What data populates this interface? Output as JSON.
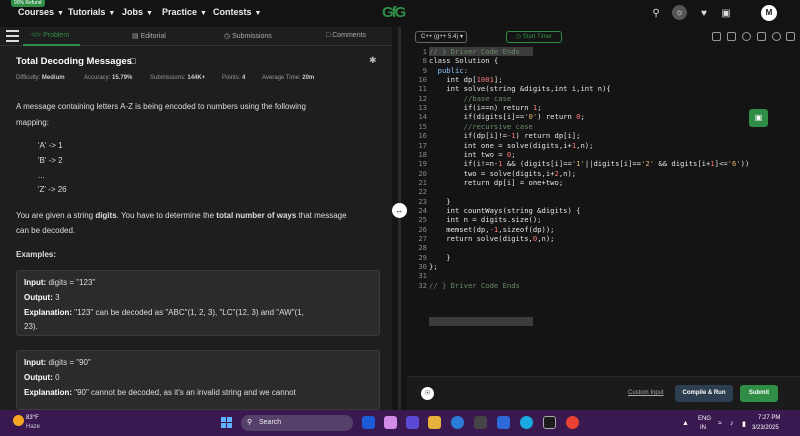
{
  "topnav": {
    "badge": "90% Refund",
    "items": [
      "Courses",
      "Tutorials",
      "Jobs",
      "Practice",
      "Contests"
    ],
    "logo": "GfG",
    "avatar_letter": "M"
  },
  "tabs": {
    "problem": "Problem",
    "editorial": "Editorial",
    "submissions": "Submissions",
    "comments": "Comments"
  },
  "problem": {
    "title": "Total Decoding Messages",
    "difficulty_label": "Difficulty:",
    "difficulty": "Medium",
    "accuracy_label": "Accuracy:",
    "accuracy": "15.79%",
    "submissions_label": "Submissions:",
    "submissions": "144K+",
    "points_label": "Points:",
    "points": "4",
    "avg_time_label": "Average Time:",
    "avg_time": "20m",
    "desc1": "A message containing letters A-Z is being encoded to numbers using the following",
    "desc2": "mapping:",
    "map1": "'A' -> 1",
    "map2": "'B' -> 2",
    "map3": "...",
    "map4": "'Z' -> 26",
    "desc3a": "You are given a string ",
    "desc3b": "digits",
    "desc3c": ". You have to determine the ",
    "desc3d": "total number of ways",
    "desc3e": " that message",
    "desc4": "can be decoded.",
    "examples": "Examples:"
  },
  "ex1": {
    "input_label": "Input:",
    "input": " digits = \"123\"",
    "output_label": "Output:",
    "output": " 3",
    "expl_label": "Explanation:",
    "expl1": " \"123\" can be decoded as \"ABC\"(1, 2, 3), \"LC\"(12, 3) and \"AW\"(1,",
    "expl2": "23)."
  },
  "ex2": {
    "input_label": "Input:",
    "input": " digits = \"90\"",
    "output_label": "Output:",
    "output": " 0",
    "expl_label": "Explanation:",
    "expl1": " \"90\" cannot be decoded, as it's an invalid string and we cannot"
  },
  "editor": {
    "language": "C++ (g++ 5.4)",
    "timer": "Start Timer",
    "line_numbers": [
      "1",
      "8",
      "9",
      "10",
      "11",
      "12",
      "13",
      "14",
      "15",
      "16",
      "17",
      "18",
      "19",
      "20",
      "21",
      "22",
      "23",
      "24",
      "25",
      "26",
      "27",
      "28",
      "29",
      "30",
      "31",
      "32"
    ],
    "custom_input": "Custom Input",
    "compile": "Compile & Run",
    "submit": "Submit"
  },
  "code": {
    "l1": "// } Driver Code Ends",
    "l8": "class Solution {",
    "l9": "  public:",
    "l10a": "    int dp[",
    "l10b": "1001",
    "l10c": "];",
    "l11": "    int solve(string &digits,int i,int n){",
    "l12": "        //base case",
    "l13a": "        if(i==n) return ",
    "l13b": "1",
    "l13c": ";",
    "l14a": "        if(digits[i]==",
    "l14b": "'0'",
    "l14c": ") return ",
    "l14d": "0",
    "l14e": ";",
    "l15": "        //recursive case",
    "l16a": "        if(dp[i]!=",
    "l16b": "-1",
    "l16c": ") return dp[i];",
    "l17a": "        int one = solve(digits,i+",
    "l17b": "1",
    "l17c": ",n);",
    "l18a": "        int two = ",
    "l18b": "0",
    "l18c": ";",
    "l19a": "        if(i!=n-",
    "l19b": "1",
    "l19c": " && (digits[i]==",
    "l19d": "'1'",
    "l19e": "||digits[i]==",
    "l19f": "'2'",
    "l19g": " && digits[i+",
    "l19h": "1",
    "l19i": "]<=",
    "l19j": "'6'",
    "l19k": "))",
    "l20a": "        two = solve(digits,i+",
    "l20b": "2",
    "l20c": ",n);",
    "l21": "        return dp[i] = one+two;",
    "l23": "    }",
    "l24": "    int countWays(string &digits) {",
    "l25": "    int n = digits.size();",
    "l26a": "    memset(dp,",
    "l26b": "-1",
    "l26c": ",sizeof(dp));",
    "l27a": "    return solve(digits,",
    "l27b": "0",
    "l27c": ",n);",
    "l29": "    }",
    "l30": "};",
    "l32": "// } Driver Code Ends"
  },
  "taskbar": {
    "temp": "83°F",
    "weather": "Haze",
    "search": "Search",
    "lang1": "ENG",
    "lang2": "IN",
    "time": "7:27 PM",
    "date": "3/23/2025"
  }
}
